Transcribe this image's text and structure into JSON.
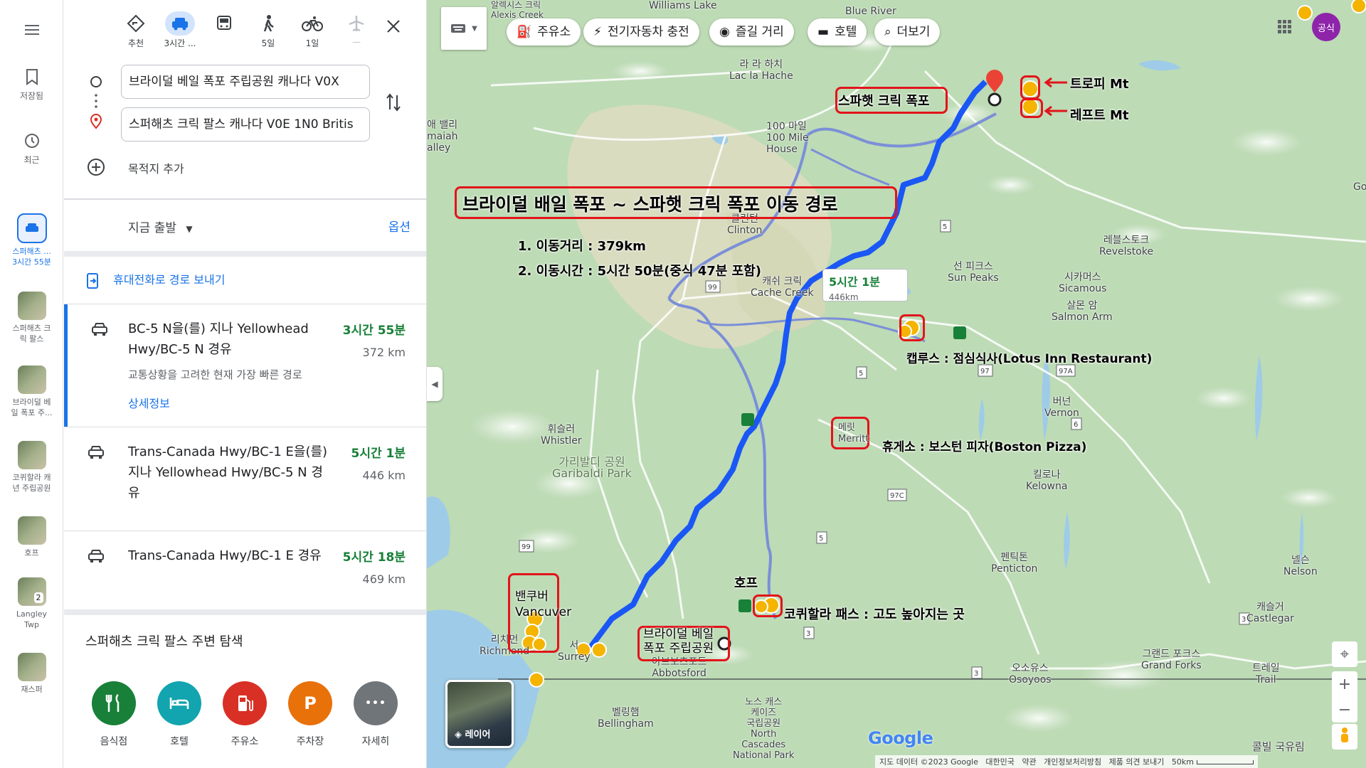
{
  "rail": {
    "saved": "저장됨",
    "recent": "최근",
    "recent_items": [
      {
        "label": "스퍼해츠 ...\n3시간 55분"
      },
      {
        "label": "스퍼해츠 크\n릭 팔스"
      },
      {
        "label": "브라이덜 베\n일 폭포 주..."
      },
      {
        "label": "코퀴할라 캐\n년 주립공원"
      },
      {
        "label": "호프"
      },
      {
        "label": "Langley\nTwp"
      },
      {
        "label": "재스퍼"
      }
    ],
    "badge": "2"
  },
  "modes": [
    {
      "label": "추천",
      "icon": "diamond-directions-icon"
    },
    {
      "label": "3시간 ...",
      "icon": "car-icon",
      "active": true
    },
    {
      "label": "",
      "icon": "bus-icon"
    },
    {
      "label": "5일",
      "icon": "walk-icon"
    },
    {
      "label": "1일",
      "icon": "bicycle-icon"
    },
    {
      "label": "—",
      "icon": "plane-icon"
    }
  ],
  "origin": "브라이덜 베일 폭포 주립공원 캐나다 V0X",
  "destination": "스퍼해츠 크릭 팔스 캐나다 V0E 1N0 Britis",
  "add_destination": "목적지 추가",
  "depart": "지금 출발",
  "options": "옵션",
  "send_to_phone": "휴대전화로 경로 보내기",
  "routes": [
    {
      "title": "BC-5 N을(를) 지나 Yellowhead Hwy/BC-5 N 경유",
      "time": "3시간 55분",
      "distance": "372 km",
      "note": "교통상황을 고려한 현재 가장 빠른 경로",
      "details": "상세정보"
    },
    {
      "title": "Trans-Canada Hwy/BC-1 E을(를) 지나 Yellowhead Hwy/BC-5 N 경유",
      "time": "5시간 1분",
      "distance": "446 km"
    },
    {
      "title": "Trans-Canada Hwy/BC-1 E 경유",
      "time": "5시간 18분",
      "distance": "469 km"
    }
  ],
  "explore": {
    "title": "스퍼해츠 크릭 팔스 주변 탐색",
    "categories": [
      {
        "label": "음식점",
        "color": "#188038",
        "icon": "fork-knife-icon"
      },
      {
        "label": "호텔",
        "color": "#12a4af",
        "icon": "bed-icon"
      },
      {
        "label": "주유소",
        "color": "#d93025",
        "icon": "fuel-icon"
      },
      {
        "label": "주차장",
        "color": "#e8710a",
        "icon": "parking-icon",
        "glyph": "P"
      },
      {
        "label": "자세히",
        "color": "#70757a",
        "icon": "more-icon",
        "glyph": "•••"
      }
    ]
  },
  "chips": [
    "주유소",
    "전기자동차 충전",
    "즐길 거리",
    "호텔",
    "더보기"
  ],
  "map": {
    "places": [
      "Williams Lake",
      "Blue River",
      "알렉시스 크릭\nAlexis Creek",
      "라 라 하치\nLac la Hache",
      "100 마일\n100 Mile\nHouse",
      "클린턴\nClinton",
      "캐쉬 크릭\nCache Creek",
      "선 피크스\nSun Peaks",
      "레블스토크\nRevelstoke",
      "시카머스\nSicamous",
      "살몬 암\nSalmon Arm",
      "버넌\nVernon",
      "휘슬러\nWhistler",
      "가리발디 공원\nGaribaldi Park",
      "킬로나\nKelowna",
      "펜틱톤\nPenticton",
      "넬슨\nNelson",
      "캐슬거\nCastlegar",
      "그랜드 포크스\nGrand Forks",
      "트레일\nTrail",
      "오소유스\nOsoyoos",
      "벨링햄\nBellingham",
      "노스 캐스\n케이즈\n국립공원\nNorth\nCascades\nNational Park",
      "콜빌 국유림",
      "아브보츠포드\nAbbotsford",
      "리치먼\nRichmond",
      "서\nSurrey",
      "애 밸리\nmaiah\nalley",
      "Go"
    ],
    "route_badge_time": "5시간 1분",
    "route_badge_dist": "446km",
    "highways": [
      "5",
      "5",
      "5",
      "99",
      "99",
      "97",
      "97A",
      "6",
      "97C",
      "3",
      "3",
      "6"
    ],
    "official": "공식",
    "layers": "레이어",
    "footer": [
      "지도 데이터 ©2023 Google",
      "대한민국",
      "약관",
      "개인정보처리방침",
      "제품 의견 보내기",
      "50km"
    ],
    "google": "Google"
  },
  "annotations": {
    "headline": "브라이덜 배일 폭포 ~ 스파햇 크릭 폭포 이동 경로",
    "line1": "1. 이동거리 : 379km",
    "line2": "2. 이동시간 : 5시간 50분(중식 47분 포함)",
    "trophy": "트로피 Mt",
    "left": "레프트 Mt",
    "spahats": "스파햇 크릭 폭포",
    "kamloops": "캡루스 : 점심식사(Lotus Inn Restaurant)",
    "merritt_box": "메릿\nMerritt",
    "rest": "휴게소 : 보스턴 피자(Boston Pizza)",
    "hope": "호프",
    "coquihalla": "코퀴할라 패스 : 고도 높아지는 곳",
    "bridal": "브라이덜 베일\n폭포 주립공원",
    "vancouver": "밴쿠버\nVancuver"
  },
  "colors": {
    "route": "#1a57f5",
    "alt_route": "#7b8fd8",
    "accent": "#1a73e8",
    "green_time": "#188038",
    "annotation_red": "#e2141b"
  }
}
